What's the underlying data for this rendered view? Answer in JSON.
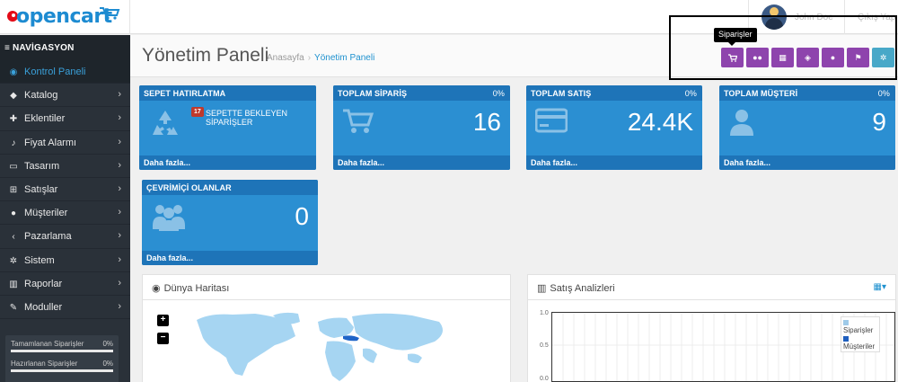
{
  "header": {
    "brand": "opencart",
    "user_name": "John Doe",
    "logout_label": "Çıkış Yap"
  },
  "sidebar": {
    "nav_title": "NAVİGASYON",
    "items": [
      {
        "label": "Kontrol Paneli",
        "icon": "dashboard-icon",
        "active": true
      },
      {
        "label": "Katalog",
        "icon": "tag-icon"
      },
      {
        "label": "Eklentiler",
        "icon": "puzzle-icon"
      },
      {
        "label": "Fiyat Alarmı",
        "icon": "bell-icon"
      },
      {
        "label": "Tasarım",
        "icon": "monitor-icon"
      },
      {
        "label": "Satışlar",
        "icon": "cart-icon"
      },
      {
        "label": "Müşteriler",
        "icon": "user-icon"
      },
      {
        "label": "Pazarlama",
        "icon": "share-icon"
      },
      {
        "label": "Sistem",
        "icon": "cog-icon"
      },
      {
        "label": "Raporlar",
        "icon": "bar-chart-icon"
      },
      {
        "label": "Moduller",
        "icon": "wrench-icon"
      }
    ],
    "stats": [
      {
        "label": "Tamamlanan Siparişler",
        "pct": "0%"
      },
      {
        "label": "Hazırlanan Siparişler",
        "pct": "0%"
      }
    ]
  },
  "page": {
    "title": "Yönetim Paneli",
    "breadcrumb": [
      "Anasayfa",
      "Yönetim Paneli"
    ]
  },
  "toolbar": {
    "tooltip": "Siparişler",
    "buttons": [
      {
        "icon": "cart-icon",
        "color": "#8e44ad"
      },
      {
        "icon": "users-icon",
        "color": "#8e44ad"
      },
      {
        "icon": "grid-icon",
        "color": "#8e44ad"
      },
      {
        "icon": "ticket-icon",
        "color": "#8e44ad"
      },
      {
        "icon": "comment-icon",
        "color": "#8e44ad"
      },
      {
        "icon": "flag-icon",
        "color": "#8e44ad"
      },
      {
        "icon": "cog-icon",
        "color": "#48a8c8"
      }
    ]
  },
  "tiles": [
    {
      "title": "SEPET HATIRLATMA",
      "badge": "17",
      "badge_label": "SEPETTE BEKLEYEN SİPARİŞLER",
      "footer": "Daha fazla...",
      "icon": "recycle-icon"
    },
    {
      "title": "TOPLAM SİPARİŞ",
      "pct": "0%",
      "value": "16",
      "footer": "Daha fazla...",
      "icon": "cart-icon"
    },
    {
      "title": "TOPLAM SATIŞ",
      "pct": "0%",
      "value": "24.4K",
      "footer": "Daha fazla...",
      "icon": "credit-card-icon"
    },
    {
      "title": "TOPLAM MÜŞTERİ",
      "pct": "0%",
      "value": "9",
      "footer": "Daha fazla...",
      "icon": "user-icon"
    },
    {
      "title": "ÇEVRİMİÇİ OLANLAR",
      "value": "0",
      "footer": "Daha fazla...",
      "icon": "users-icon"
    }
  ],
  "map_panel": {
    "title": "Dünya Haritası",
    "zoom_in": "+",
    "zoom_out": "−"
  },
  "sales_panel": {
    "title": "Satış Analizleri",
    "legend": [
      "Siparişler",
      "Müşteriler"
    ],
    "yticks": [
      "1.0",
      "0.5",
      "0.0"
    ],
    "colors": {
      "orders": "#9ecae9",
      "customers": "#1f5fbf"
    }
  },
  "colors": {
    "accent": "#1e91cf",
    "tile": "#2b8fd2",
    "tile_dark": "#1e74b8",
    "sidebar": "#2a3139",
    "toolbar_purple": "#8e44ad"
  }
}
